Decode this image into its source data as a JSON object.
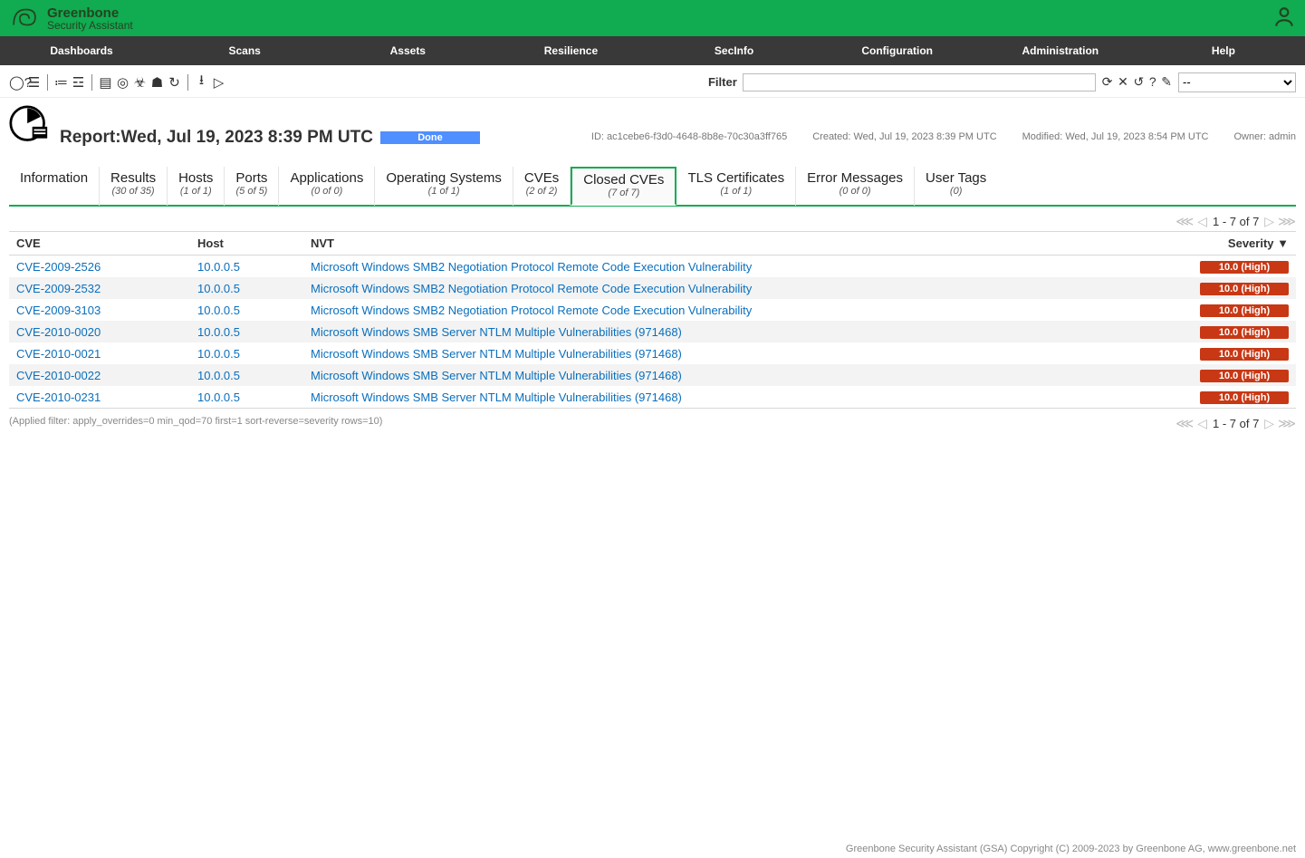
{
  "brand": {
    "line1": "Greenbone",
    "line2": "Security Assistant"
  },
  "nav": [
    "Dashboards",
    "Scans",
    "Assets",
    "Resilience",
    "SecInfo",
    "Configuration",
    "Administration",
    "Help"
  ],
  "filter": {
    "label": "Filter",
    "value": "",
    "select": "--"
  },
  "report": {
    "title": "Report:Wed, Jul 19, 2023 8:39 PM UTC",
    "status": "Done",
    "id_label": "ID:",
    "id": "ac1cebe6-f3d0-4648-8b8e-70c30a3ff765",
    "created_label": "Created:",
    "created": "Wed, Jul 19, 2023 8:39 PM UTC",
    "modified_label": "Modified:",
    "modified": "Wed, Jul 19, 2023 8:54 PM UTC",
    "owner_label": "Owner:",
    "owner": "admin"
  },
  "tabs": [
    {
      "label": "Information",
      "count": ""
    },
    {
      "label": "Results",
      "count": "(30 of 35)"
    },
    {
      "label": "Hosts",
      "count": "(1 of 1)"
    },
    {
      "label": "Ports",
      "count": "(5 of 5)"
    },
    {
      "label": "Applications",
      "count": "(0 of 0)"
    },
    {
      "label": "Operating Systems",
      "count": "(1 of 1)"
    },
    {
      "label": "CVEs",
      "count": "(2 of 2)"
    },
    {
      "label": "Closed CVEs",
      "count": "(7 of 7)"
    },
    {
      "label": "TLS Certificates",
      "count": "(1 of 1)"
    },
    {
      "label": "Error Messages",
      "count": "(0 of 0)"
    },
    {
      "label": "User Tags",
      "count": "(0)"
    }
  ],
  "active_tab_index": 7,
  "pager": "1 - 7 of 7",
  "columns": {
    "cve": "CVE",
    "host": "Host",
    "nvt": "NVT",
    "severity": "Severity ▼"
  },
  "rows": [
    {
      "cve": "CVE-2009-2526",
      "host": "10.0.0.5",
      "nvt": "Microsoft Windows SMB2 Negotiation Protocol Remote Code Execution Vulnerability",
      "sev": "10.0 (High)"
    },
    {
      "cve": "CVE-2009-2532",
      "host": "10.0.0.5",
      "nvt": "Microsoft Windows SMB2 Negotiation Protocol Remote Code Execution Vulnerability",
      "sev": "10.0 (High)"
    },
    {
      "cve": "CVE-2009-3103",
      "host": "10.0.0.5",
      "nvt": "Microsoft Windows SMB2 Negotiation Protocol Remote Code Execution Vulnerability",
      "sev": "10.0 (High)"
    },
    {
      "cve": "CVE-2010-0020",
      "host": "10.0.0.5",
      "nvt": "Microsoft Windows SMB Server NTLM Multiple Vulnerabilities (971468)",
      "sev": "10.0 (High)"
    },
    {
      "cve": "CVE-2010-0021",
      "host": "10.0.0.5",
      "nvt": "Microsoft Windows SMB Server NTLM Multiple Vulnerabilities (971468)",
      "sev": "10.0 (High)"
    },
    {
      "cve": "CVE-2010-0022",
      "host": "10.0.0.5",
      "nvt": "Microsoft Windows SMB Server NTLM Multiple Vulnerabilities (971468)",
      "sev": "10.0 (High)"
    },
    {
      "cve": "CVE-2010-0231",
      "host": "10.0.0.5",
      "nvt": "Microsoft Windows SMB Server NTLM Multiple Vulnerabilities (971468)",
      "sev": "10.0 (High)"
    }
  ],
  "applied_filter": "(Applied filter: apply_overrides=0 min_qod=70 first=1 sort-reverse=severity rows=10)",
  "footer": "Greenbone Security Assistant (GSA) Copyright (C) 2009-2023 by Greenbone AG, www.greenbone.net"
}
